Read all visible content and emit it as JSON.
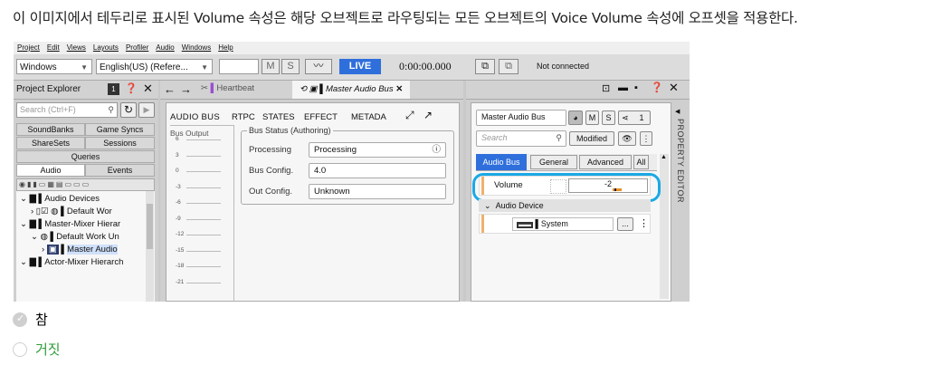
{
  "question": "이 이미지에서 테두리로 표시된 Volume 속성은 해당 오브젝트로 라우팅되는 모든 오브젝트의 Voice Volume 속성에 오프셋을 적용한다.",
  "menu": [
    "Project",
    "Edit",
    "Views",
    "Layouts",
    "Profiler",
    "Audio",
    "Windows",
    "Help"
  ],
  "toolbar": {
    "layout_select": "Windows",
    "language_select": "English(US) (Refere...",
    "mute_label": "M",
    "solo_label": "S",
    "live_label": "LIVE",
    "time": "0:00:00.000",
    "connection_status": "Not connected"
  },
  "project_explorer": {
    "title": "Project Explorer",
    "badge": "1",
    "search_placeholder": "Search (Ctrl+F)",
    "tabs_row1": [
      "SoundBanks",
      "Game Syncs"
    ],
    "tabs_row2": [
      "ShareSets",
      "Sessions"
    ],
    "tabs_row3": [
      "Queries"
    ],
    "tabs_row4": [
      "Audio",
      "Events"
    ],
    "tree": [
      "Audio Devices",
      "Default Wor",
      "Master-Mixer Hierar",
      "Default Work Un",
      "Master Audio",
      "Actor-Mixer Hierarch"
    ]
  },
  "editor": {
    "tabs": [
      "Heartbeat",
      "Master Audio Bus"
    ],
    "subtabs": [
      "AUDIO BUS",
      "RTPC",
      "STATES",
      "EFFECT",
      "METADA"
    ],
    "bus_output_label": "Bus Output",
    "meter_ticks": [
      "6",
      "3",
      "0",
      "-3",
      "-6",
      "-9",
      "-12",
      "-15",
      "-18",
      "-21"
    ],
    "bus_status_title": "Bus Status (Authoring)",
    "rows": [
      {
        "label": "Processing",
        "value": "Processing"
      },
      {
        "label": "Bus Config.",
        "value": "4.0"
      },
      {
        "label": "Out Config.",
        "value": "Unknown"
      }
    ]
  },
  "property_editor": {
    "side_title": "PROPERTY EDITOR",
    "object_name": "Master Audio Bus",
    "mute_label": "M",
    "solo_label": "S",
    "count": "1",
    "search_placeholder": "Search",
    "modified_label": "Modified",
    "tabs": [
      "Audio Bus",
      "General",
      "Advanced",
      "All"
    ],
    "volume_label": "Volume",
    "volume_value": "-2",
    "group_label": "Audio Device",
    "device_value": "System",
    "ellipsis": "..."
  },
  "options": [
    {
      "label": "참",
      "state": "selected-disabled"
    },
    {
      "label": "거짓",
      "state": "unselected"
    }
  ],
  "colors": {
    "accent_blue": "#2f6fdc",
    "highlight_ring": "#1aa9e6",
    "tab_active": "#2f6fdc",
    "option_false_text": "#2e9b3a",
    "purple_bar": "#9b4fd0"
  }
}
